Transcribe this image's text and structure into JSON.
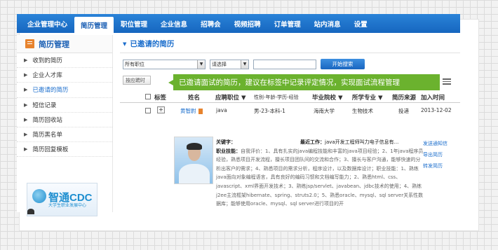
{
  "nav": {
    "tabs": [
      "企业管理中心",
      "简历管理",
      "职位管理",
      "企业信息",
      "招聘会",
      "视频招聘",
      "订单管理",
      "站内消息",
      "设置"
    ],
    "active_index": 1
  },
  "sidebar": {
    "title": "简历管理",
    "items": [
      {
        "label": "收到的简历",
        "active": false
      },
      {
        "label": "企业人才库",
        "active": false
      },
      {
        "label": "已邀请的简历",
        "active": true
      },
      {
        "label": "短信记录",
        "active": false
      },
      {
        "label": "简历回收站",
        "active": false
      },
      {
        "label": "简历黑名单",
        "active": false
      },
      {
        "label": "简历回复模板",
        "active": false
      }
    ],
    "logo": {
      "text": "智通CDC",
      "sub": "大学生职业发展中心"
    }
  },
  "main": {
    "section_title": "已邀请的简历",
    "filter": {
      "position_select": "所有职位",
      "second_select": "请选择",
      "search_button": "开始搜索"
    },
    "small_button": "按应聘时",
    "tooltip": "已邀请面试的简历，建议在标签中记录评定情况，实现面试流程管理",
    "table": {
      "headers": {
        "tag": "标签",
        "name": "姓名",
        "position": "应聘职位",
        "info": "性别-年龄-学历-经验",
        "school": "毕业院校",
        "major": "所学专业",
        "source": "简历来源",
        "time": "加入时间"
      },
      "row": {
        "name": "黄智尉",
        "position": "java",
        "info": "男-23-本科-1",
        "school": "海南大学",
        "major": "生物技术",
        "source": "投递",
        "time": "2013-12-02"
      }
    },
    "detail": {
      "keyword_label": "关键字：",
      "recent_work_label": "最近工作：",
      "recent_work": "java开发工程师叫力电子信息有...",
      "skills_label": "职业技能：",
      "skills_text": "自我评价：1、具有扎实的java编程技能和丰富的java项目经验；2、1年java程序员经验，熟悉项目开发流程，擅长项目团队间的交流和合作；3、擅长与客户沟通，能够快速的分析出客户的需求；4、熟悉项目的需求分析，程序设计，以及数据库设计；职业技能：1、熟练java面向对象编程语言，具有良好的编码习惯和文档编写能力；2、熟悉html、css、javascript、xml界面开发技术；3、熟练jsp/servlet、javabean、jdbc技术的使用；4、熟练j2ee主流框架hibernate、spring、struts2.0；5、熟悉oracle、mysql、sql server关系性数据库；能够使用oracle、mysql、sql server进行项目的开"
    },
    "actions": [
      "发送通知信",
      "导出简历",
      "转发简历"
    ]
  }
}
